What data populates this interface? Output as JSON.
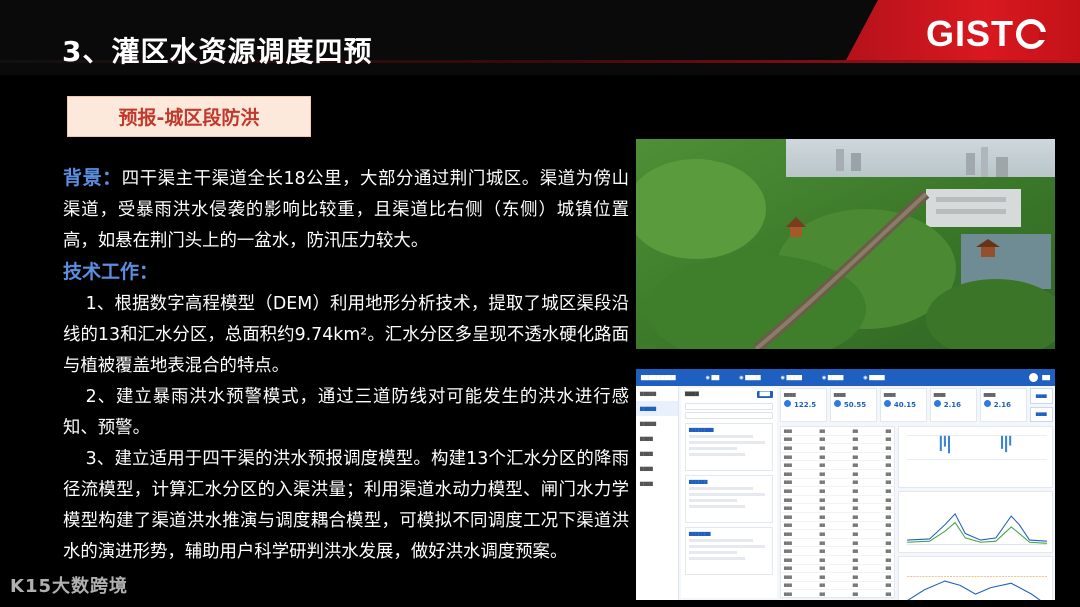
{
  "header": {
    "title": "3、灌区水资源调度四预",
    "logo": "GISTC"
  },
  "section": {
    "badge": "预报-城区段防洪"
  },
  "content": {
    "background_label": "背景：",
    "background_text": "四干渠主干渠道全长18公里，大部分通过荆门城区。渠道为傍山渠道，受暴雨洪水侵袭的影响比较重，且渠道比右侧（东侧）城镇位置高，如悬在荆门头上的一盆水，防汛压力较大。",
    "tech_label": "技术工作：",
    "items": [
      "1、根据数字高程模型（DEM）利用地形分析技术，提取了城区渠段沿线的13和汇水分区，总面积约9.74km²。汇水分区多呈现不透水硬化路面与植被覆盖地表混合的特点。",
      "2、建立暴雨洪水预警模式，通过三道防线对可能发生的洪水进行感知、预警。",
      "3、建立适用于四干渠的洪水预报调度模型。构建13个汇水分区的降雨径流模型，计算汇水分区的入渠洪量；利用渠道水动力模型、闸门水力学模型构建了渠道洪水推演与调度耦合模型，可模拟不同调度工况下渠道洪水的演进形势，辅助用户科学研判洪水发展，做好洪水调度预案。"
    ]
  },
  "dashboard": {
    "stats": [
      {
        "value": "122.5"
      },
      {
        "value": "50.55"
      },
      {
        "value": "40.15"
      },
      {
        "value": "2.16"
      },
      {
        "value": "2.16"
      }
    ]
  },
  "watermark": "K15大数跨境",
  "colors": {
    "accent_red": "#c21218",
    "label_blue": "#5b8fe0",
    "badge_bg": "#fde8dc",
    "badge_text": "#c0392b"
  }
}
